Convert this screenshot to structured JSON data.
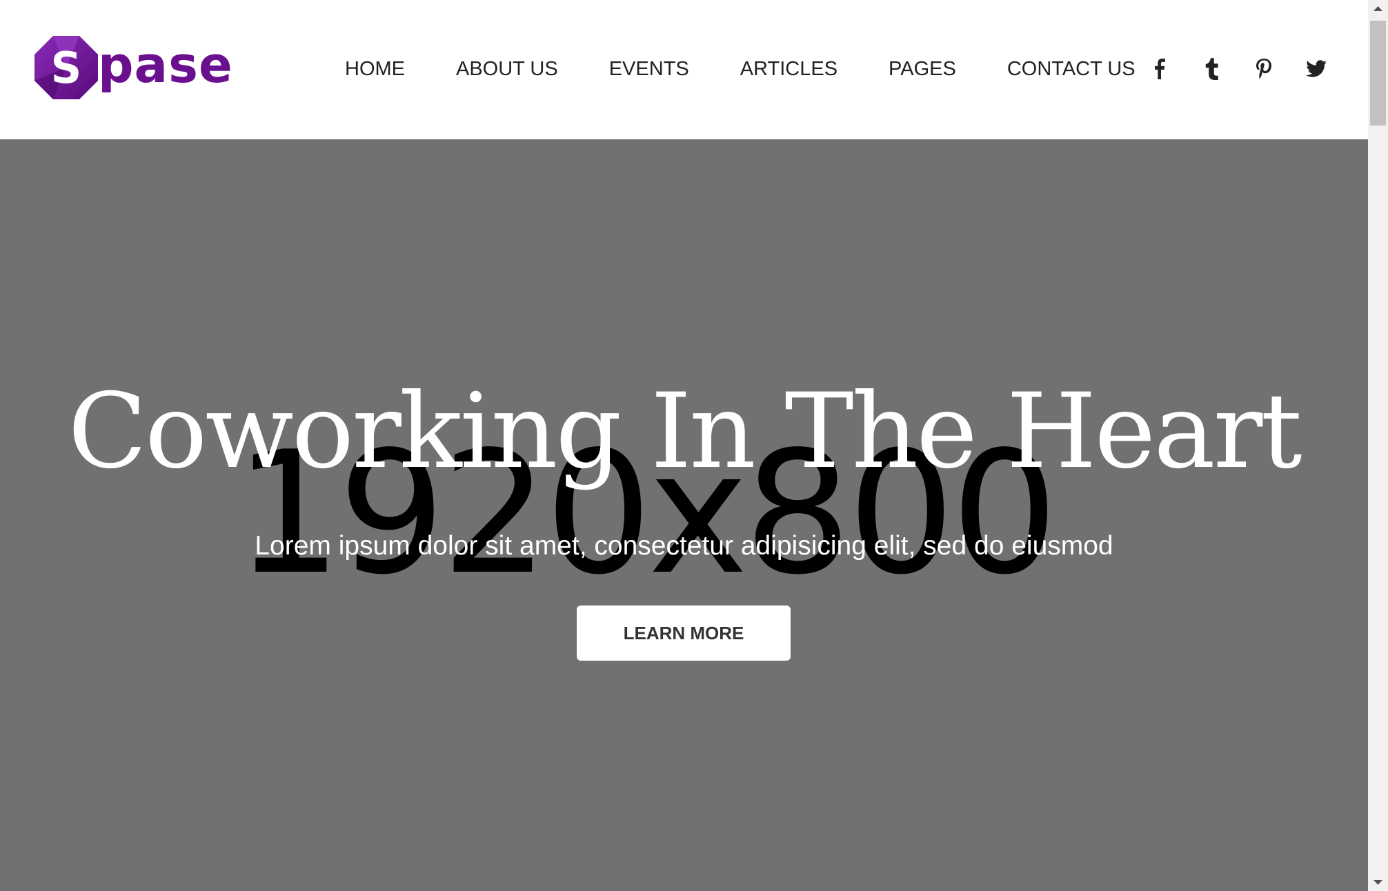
{
  "brand": {
    "logo_letter": "S",
    "logo_word": "pase",
    "colors": {
      "brand_purple": "#6a0f8e",
      "badge_dark": "#5a0a7a",
      "badge_light": "#8a2bb8"
    }
  },
  "nav": {
    "items": [
      {
        "label": "HOME"
      },
      {
        "label": "ABOUT US"
      },
      {
        "label": "EVENTS"
      },
      {
        "label": "ARTICLES"
      },
      {
        "label": "PAGES"
      },
      {
        "label": "CONTACT US"
      }
    ]
  },
  "social": {
    "icons": [
      "facebook-icon",
      "tumblr-icon",
      "pinterest-icon",
      "twitter-icon"
    ]
  },
  "hero": {
    "placeholder": "1920x800",
    "title": "Coworking In The Heart",
    "subtitle": "Lorem ipsum dolor sit amet, consectetur adipisicing elit, sed do eiusmod",
    "button_label": "LEARN MORE",
    "background_color": "#717171"
  }
}
